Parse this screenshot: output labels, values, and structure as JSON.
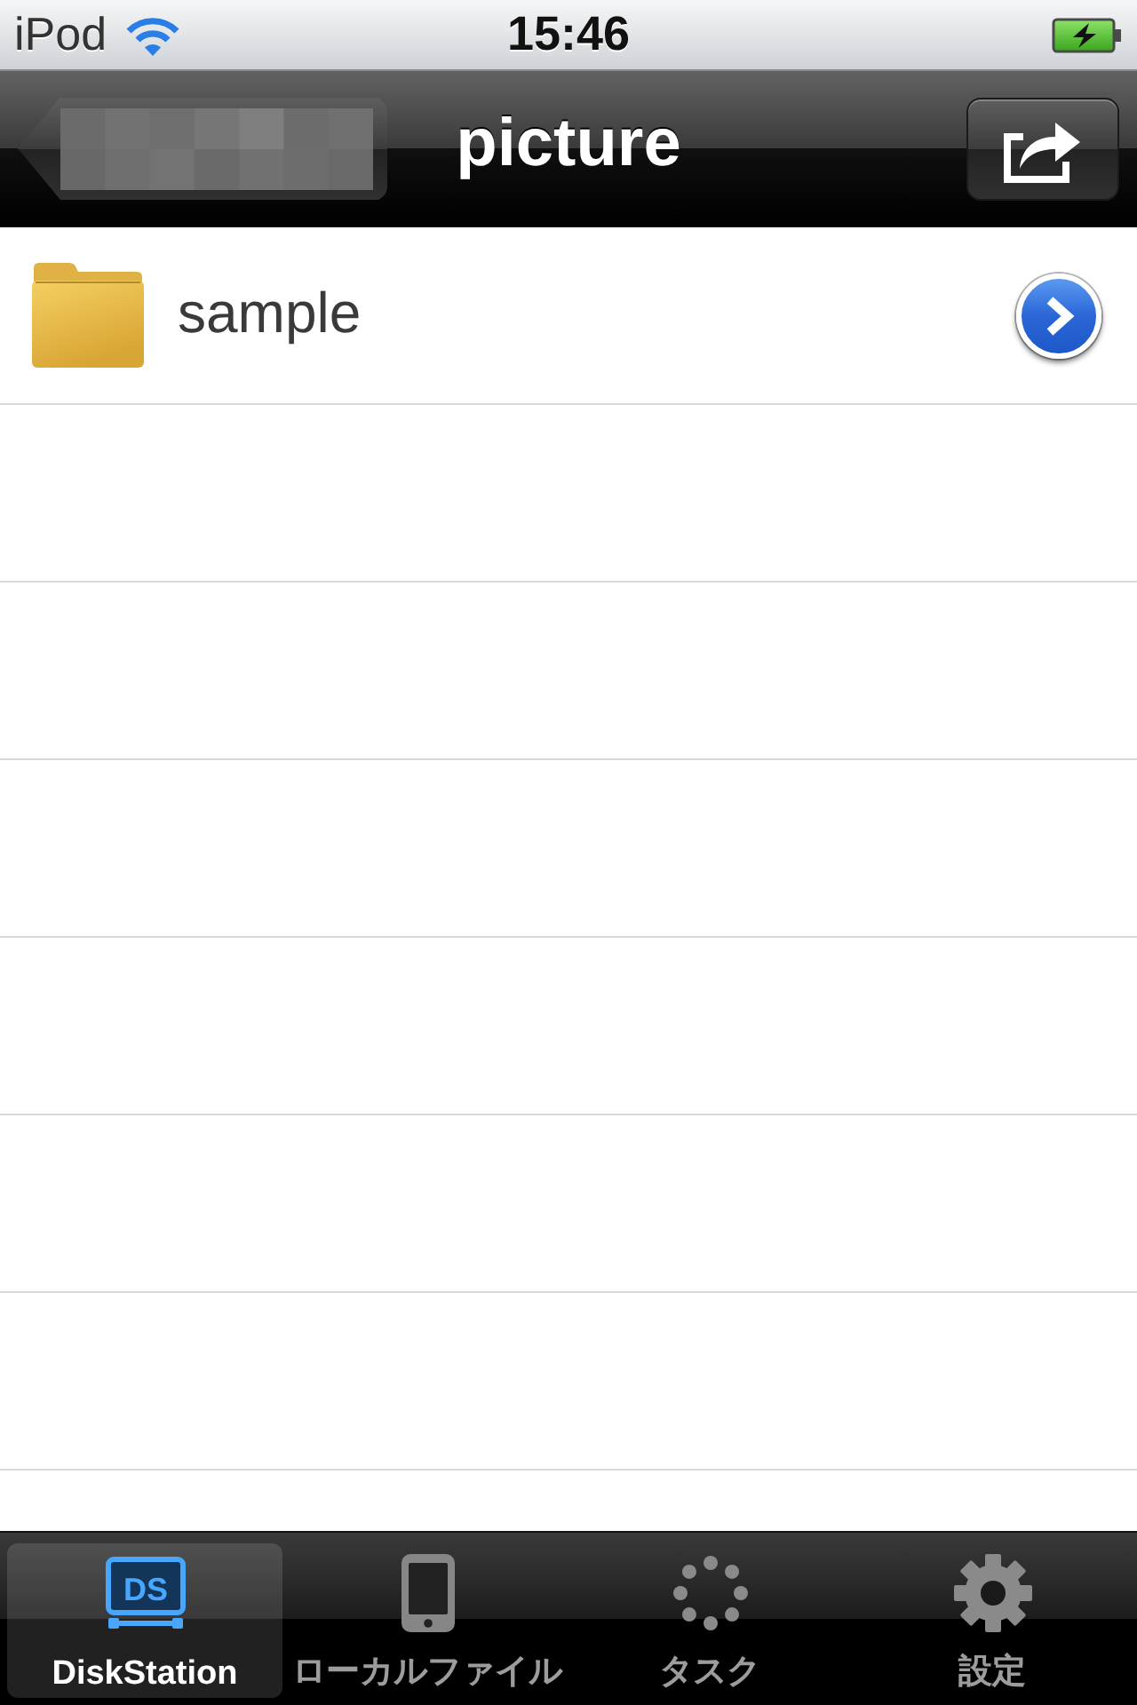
{
  "status_bar": {
    "carrier": "iPod",
    "time": "15:46"
  },
  "nav_bar": {
    "title": "picture"
  },
  "rows": [
    {
      "name": "sample"
    }
  ],
  "tabs": [
    {
      "label": "DiskStation",
      "icon_text": "DS",
      "selected": true
    },
    {
      "label": "ローカルファイル",
      "selected": false
    },
    {
      "label": "タスク",
      "selected": false
    },
    {
      "label": "設定",
      "selected": false
    }
  ]
}
